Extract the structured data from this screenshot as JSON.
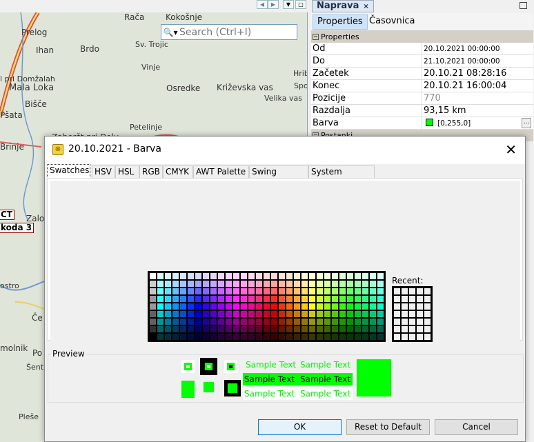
{
  "map": {
    "search_placeholder": "Search (Ctrl+I)",
    "search_icon": "magnifier-dropdown-icon",
    "labels": [
      "Rača",
      "Kokošnje",
      "Prelog",
      "Ihan",
      "Brdo",
      "Sv. Trojic",
      "Vinje",
      "l pri Domžalah",
      "Mala Loka",
      "Osredke",
      "Križevska vas",
      "Velika vas",
      "Hrib",
      "Spo",
      "Bišče",
      "Pšata",
      "Petelinje",
      "Zaboršt pri Dolu",
      "Brinje",
      "Zalog",
      "ostro",
      "Če",
      "molnik",
      "Po",
      "Šentp",
      "Pleše"
    ],
    "markers": [
      "CT",
      "koda 3"
    ]
  },
  "panel": {
    "title": "Naprava",
    "close": "×",
    "tabs": [
      "Properties",
      "Časovnica"
    ],
    "section": "Properties",
    "section2": "Postanki",
    "rows": [
      {
        "key": "Od",
        "value": "20.10.2021 00:00:00"
      },
      {
        "key": "Do",
        "value": "21.10.2021 00:00:00"
      },
      {
        "key": "Začetek",
        "value": "20.10.21 08:28:16"
      },
      {
        "key": "Konec",
        "value": "20.10.21 16:00:04"
      },
      {
        "key": "Pozicije",
        "value": "770"
      },
      {
        "key": "Razdalja",
        "value": "93,15 km"
      },
      {
        "key": "Barva",
        "value": "[0,255,0]",
        "color": "#00ff00"
      }
    ],
    "more_button": "..."
  },
  "dialog": {
    "title": "20.10.2021 - Barva",
    "close": "✕",
    "tabs": [
      "Swatches",
      "HSV",
      "HSL",
      "RGB",
      "CMYK",
      "AWT Palette",
      "Swing Palette",
      "System Palette"
    ],
    "active_tab": "Swatches",
    "recent_label": "Recent:",
    "preview_label": "Preview",
    "sample_text": "Sample Text",
    "selected_color": "#00ff00",
    "buttons": {
      "ok": "OK",
      "reset": "Reset to Default",
      "cancel": "Cancel"
    }
  }
}
